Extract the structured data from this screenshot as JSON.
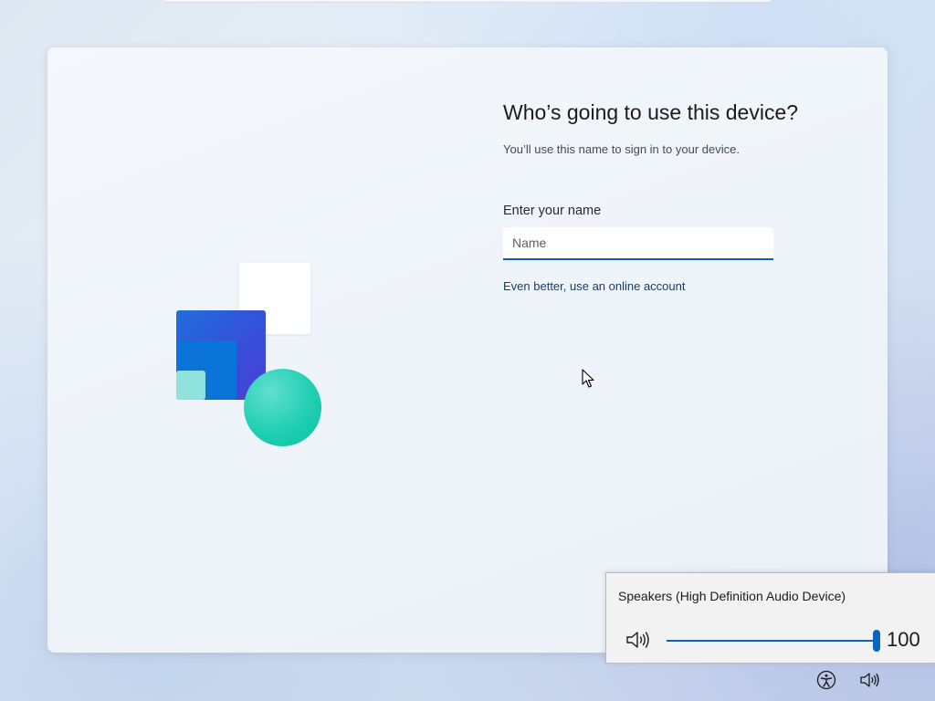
{
  "setup": {
    "heading": "Who’s going to use this device?",
    "subheading": "You’ll use this name to sign in to your device.",
    "name_field": {
      "label": "Enter your name",
      "value": "",
      "placeholder": "Name"
    },
    "online_account_link": "Even better, use an online account"
  },
  "illustration": {
    "icon": "user-accounts-illustration",
    "colors": {
      "blue": "#1f6fdc",
      "indigo": "#4b3fd4",
      "mint": "#8fe3dc",
      "teal": "#21cfb3"
    }
  },
  "volume_flyout": {
    "device_name": "Speakers (High Definition Audio Device)",
    "icon": "speaker-icon",
    "level": 100,
    "level_text": "100",
    "accent_color": "#0a64c2"
  },
  "tray": {
    "icons": [
      "accessibility-icon",
      "volume-icon"
    ]
  }
}
